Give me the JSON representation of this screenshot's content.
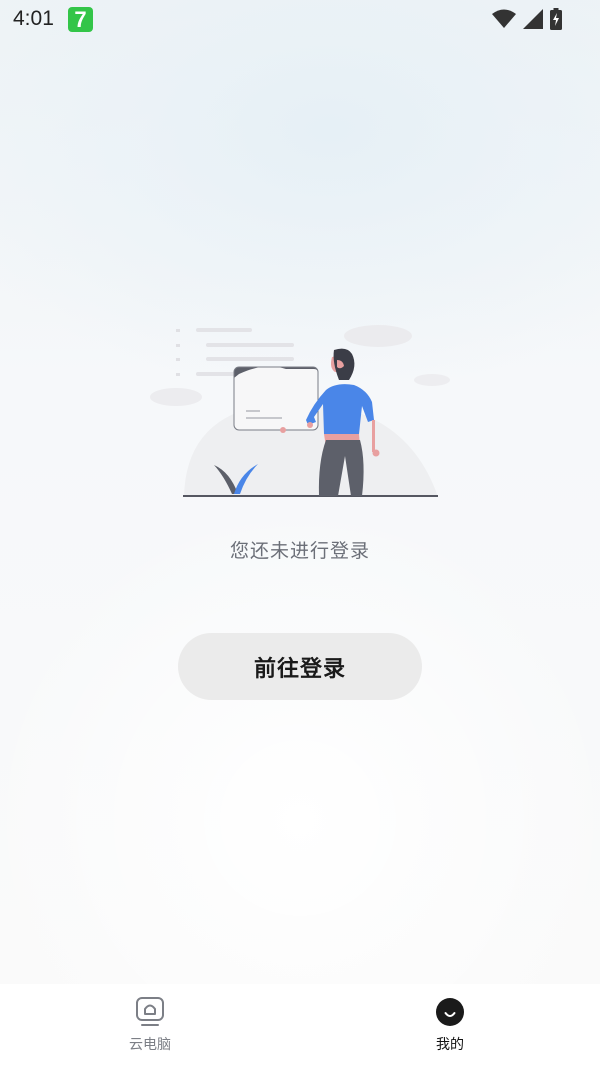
{
  "status_bar": {
    "time": "4:01",
    "app_badge": "7",
    "icons": [
      "wifi-icon",
      "cell-signal-icon",
      "battery-charging-icon"
    ]
  },
  "main": {
    "empty_state_text": "您还未进行登录",
    "login_button_label": "前往登录"
  },
  "bottom_nav": {
    "items": [
      {
        "label": "云电脑",
        "icon": "cloud-pc-icon",
        "active": false
      },
      {
        "label": "我的",
        "icon": "profile-smile-icon",
        "active": true
      }
    ]
  },
  "colors": {
    "accent_blue": "#4a86e8",
    "button_bg": "#ebebeb",
    "badge_green": "#33c548"
  }
}
